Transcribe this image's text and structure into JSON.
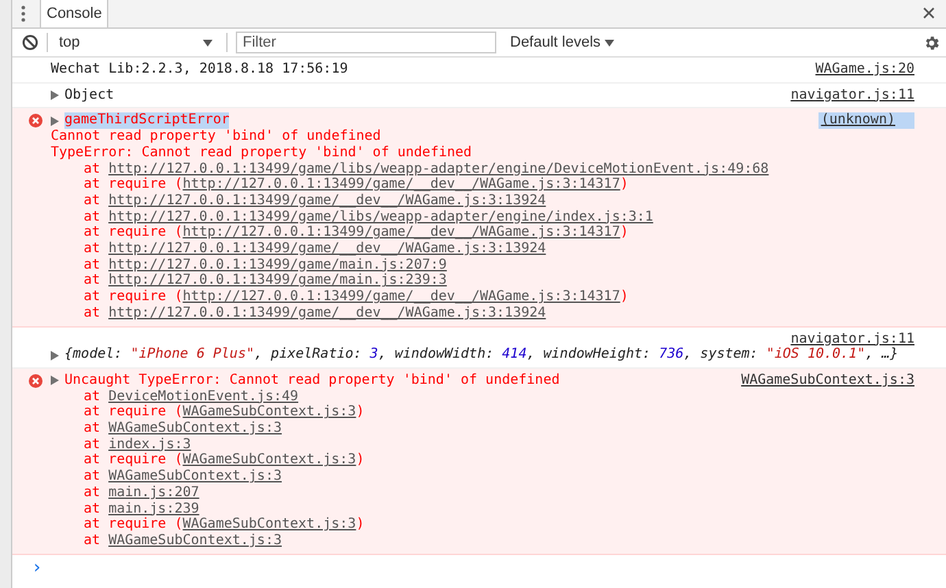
{
  "tabs": [
    {
      "label": "Console",
      "selected": true
    }
  ],
  "toolbar": {
    "context": "top",
    "filter": {
      "placeholder": "Filter"
    },
    "levels": "Default levels"
  },
  "messages": [
    {
      "kind": "log",
      "text": "Wechat Lib:2.2.3, 2018.8.18 17:56:19",
      "source": "WAGame.js:20"
    },
    {
      "kind": "object",
      "expanded": false,
      "text": "Object",
      "source": "navigator.js:11"
    },
    {
      "kind": "error",
      "expanded": false,
      "highlighted": true,
      "title": "gameThirdScriptError",
      "source": "(unknown)",
      "lines": [
        "Cannot read property 'bind' of undefined",
        "TypeError: Cannot read property 'bind' of undefined"
      ],
      "stack": [
        {
          "at": "at",
          "link": "http://127.0.0.1:13499/game/libs/weapp-adapter/engine/DeviceMotionEvent.js:49:68"
        },
        {
          "at": "at require (",
          "link": "http://127.0.0.1:13499/game/__dev__/WAGame.js:3:14317",
          "close": ")"
        },
        {
          "at": "at",
          "link": "http://127.0.0.1:13499/game/__dev__/WAGame.js:3:13924"
        },
        {
          "at": "at",
          "link": "http://127.0.0.1:13499/game/libs/weapp-adapter/engine/index.js:3:1"
        },
        {
          "at": "at require (",
          "link": "http://127.0.0.1:13499/game/__dev__/WAGame.js:3:14317",
          "close": ")"
        },
        {
          "at": "at",
          "link": "http://127.0.0.1:13499/game/__dev__/WAGame.js:3:13924"
        },
        {
          "at": "at",
          "link": "http://127.0.0.1:13499/game/main.js:207:9"
        },
        {
          "at": "at",
          "link": "http://127.0.0.1:13499/game/main.js:239:3"
        },
        {
          "at": "at require (",
          "link": "http://127.0.0.1:13499/game/__dev__/WAGame.js:3:14317",
          "close": ")"
        },
        {
          "at": "at",
          "link": "http://127.0.0.1:13499/game/__dev__/WAGame.js:3:13924"
        }
      ]
    },
    {
      "kind": "preview",
      "expanded": false,
      "source": "navigator.js:11",
      "segments": [
        {
          "kind": "punct",
          "text": "{"
        },
        {
          "kind": "key",
          "text": "model: "
        },
        {
          "kind": "string",
          "text": "\"iPhone 6 Plus\""
        },
        {
          "kind": "punct",
          "text": ", "
        },
        {
          "kind": "key",
          "text": "pixelRatio: "
        },
        {
          "kind": "number",
          "text": "3"
        },
        {
          "kind": "punct",
          "text": ", "
        },
        {
          "kind": "key",
          "text": "windowWidth: "
        },
        {
          "kind": "number",
          "text": "414"
        },
        {
          "kind": "punct",
          "text": ", "
        },
        {
          "kind": "key",
          "text": "windowHeight: "
        },
        {
          "kind": "number",
          "text": "736"
        },
        {
          "kind": "punct",
          "text": ", "
        },
        {
          "kind": "key",
          "text": "system: "
        },
        {
          "kind": "string",
          "text": "\"iOS 10.0.1\""
        },
        {
          "kind": "punct",
          "text": ", …}"
        }
      ]
    },
    {
      "kind": "error",
      "expanded": false,
      "highlighted": false,
      "title": "Uncaught TypeError: Cannot read property 'bind' of undefined",
      "source": "WAGameSubContext.js:3",
      "stack": [
        {
          "at": "at",
          "link": "DeviceMotionEvent.js:49"
        },
        {
          "at": "at require (",
          "link": "WAGameSubContext.js:3",
          "close": ")"
        },
        {
          "at": "at",
          "link": "WAGameSubContext.js:3"
        },
        {
          "at": "at",
          "link": "index.js:3"
        },
        {
          "at": "at require (",
          "link": "WAGameSubContext.js:3",
          "close": ")"
        },
        {
          "at": "at",
          "link": "WAGameSubContext.js:3"
        },
        {
          "at": "at",
          "link": "main.js:207"
        },
        {
          "at": "at",
          "link": "main.js:239"
        },
        {
          "at": "at require (",
          "link": "WAGameSubContext.js:3",
          "close": ")"
        },
        {
          "at": "at",
          "link": "WAGameSubContext.js:3"
        }
      ]
    }
  ],
  "prompt": "›"
}
